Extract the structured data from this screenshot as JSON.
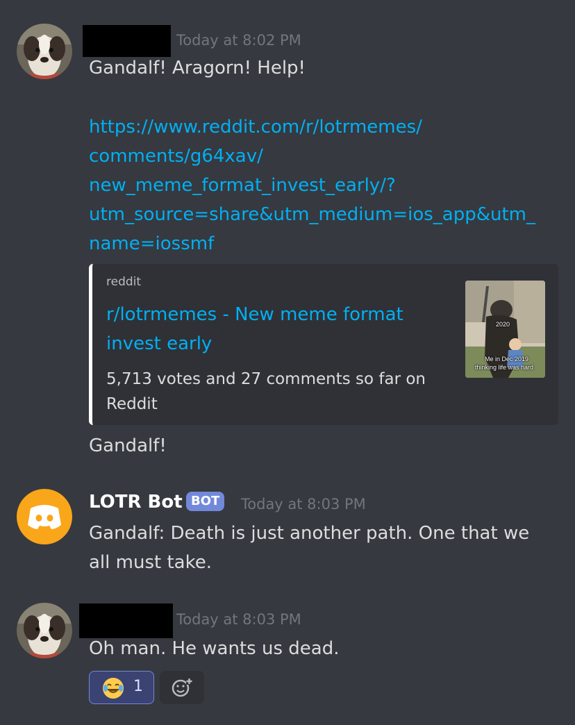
{
  "messages": [
    {
      "timestamp": "Today at 8:02 PM",
      "text": "Gandalf! Aragorn! Help!",
      "link_lines": [
        "https://www.reddit.com/r/lotrmemes/",
        "comments/g64xav/",
        "new_meme_format_invest_early/?",
        "utm_source=share&utm_medium=ios_app&utm_",
        "name=iossmf"
      ],
      "embed": {
        "provider": "reddit",
        "title": "r/lotrmemes - New meme format invest early",
        "description": "5,713 votes and 27 comments so far on Reddit",
        "thumb_labels": [
          "2020",
          "Me in Dec 2019",
          "thinking life was hard"
        ]
      },
      "followup": "Gandalf!"
    },
    {
      "username": "LOTR Bot",
      "tag": "BOT",
      "timestamp": "Today at 8:03 PM",
      "text": "Gandalf: Death is just another path. One that we all must take."
    },
    {
      "timestamp": "Today at 8:03 PM",
      "text": "Oh man. He wants us dead.",
      "reactions": [
        {
          "emoji": "joy-emoji",
          "count": "1"
        }
      ],
      "add_reaction_icon": "add-reaction-icon"
    }
  ],
  "colors": {
    "background": "#36393f",
    "link": "#00b0f4",
    "bot_tag": "#7289da",
    "discord_avatar": "#faa61a"
  }
}
